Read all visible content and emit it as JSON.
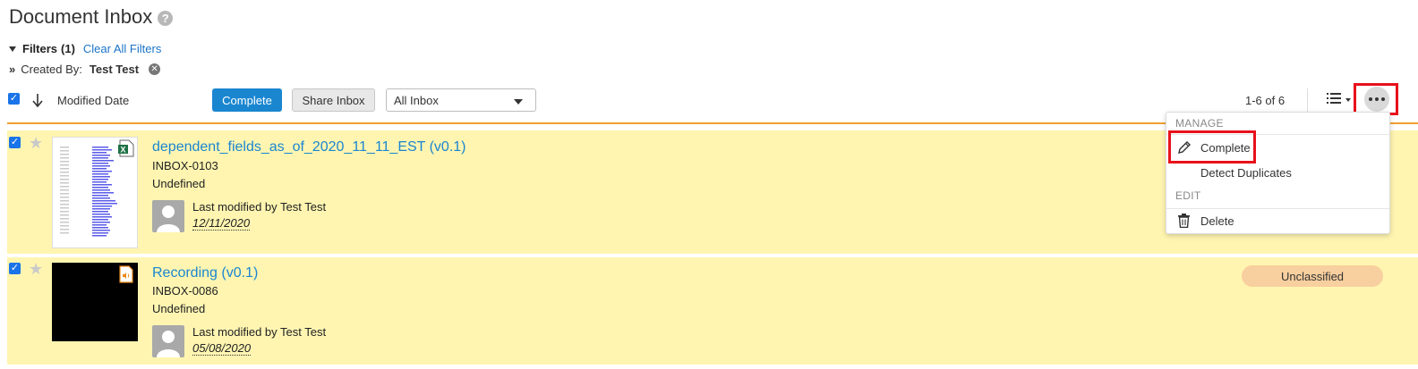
{
  "page": {
    "title": "Document Inbox",
    "help_symbol": "?"
  },
  "filters": {
    "toggle_label": "Filters",
    "count": "(1)",
    "clear_label": "Clear All Filters",
    "created_by_label": "Created By:",
    "created_by_value": "Test Test"
  },
  "toolbar": {
    "sort_label": "Modified Date",
    "complete_label": "Complete",
    "share_label": "Share Inbox",
    "inbox_select_value": "All Inbox",
    "count_text": "1-6 of 6"
  },
  "menu": {
    "manage_header": "MANAGE",
    "complete_label": "Complete",
    "detect_duplicates_label": "Detect Duplicates",
    "edit_header": "EDIT",
    "delete_label": "Delete"
  },
  "documents": [
    {
      "title": "dependent_fields_as_of_2020_11_11_EST (v0.1)",
      "id": "INBOX-0103",
      "type": "Undefined",
      "modified_by": "Last modified by Test Test",
      "modified_date": "12/11/2020",
      "file_icon": "excel-file-icon",
      "selected": true
    },
    {
      "title": "Recording (v0.1)",
      "id": "INBOX-0086",
      "type": "Undefined",
      "modified_by": "Last modified by Test Test",
      "modified_date": "05/08/2020",
      "file_icon": "audio-file-icon",
      "badge": "Unclassified",
      "selected": true
    }
  ],
  "colors": {
    "accent": "#1a86d0",
    "row_highlight": "#fff5b1",
    "badge_bg": "#f8cf9e",
    "annotation_red": "#e8111b",
    "divider_orange": "#f0a030"
  }
}
